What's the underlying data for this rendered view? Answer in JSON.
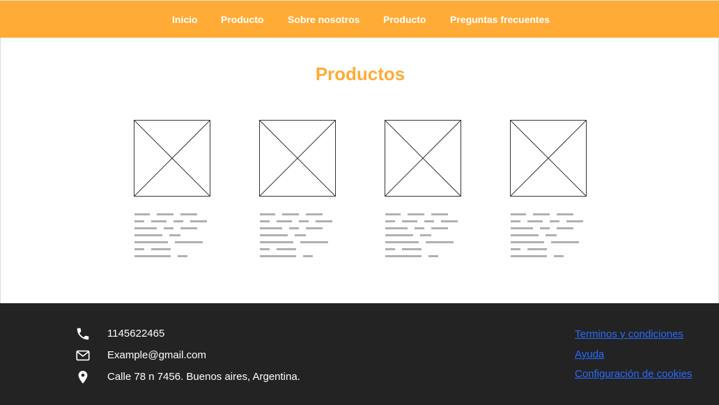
{
  "nav": {
    "items": [
      {
        "label": "Inicio"
      },
      {
        "label": "Producto"
      },
      {
        "label": "Sobre nosotros"
      },
      {
        "label": "Producto"
      },
      {
        "label": "Preguntas frecuentes"
      }
    ]
  },
  "main": {
    "title": "Productos",
    "product_count": 4
  },
  "footer": {
    "contact": [
      {
        "icon": "phone-icon",
        "text": "1145622465"
      },
      {
        "icon": "mail-icon",
        "text": "Example@gmail.com"
      },
      {
        "icon": "location-pin-icon",
        "text": "Calle 78 n 7456. Buenos aires, Argentina."
      }
    ],
    "links": [
      {
        "label": "Terminos y condiciones"
      },
      {
        "label": "Ayuda"
      },
      {
        "label": "Configuración de cookies"
      }
    ]
  },
  "colors": {
    "accent": "#ffab36",
    "footer_bg": "#232323",
    "link": "#2a6bff",
    "placeholder_text": "#b0b0b0"
  }
}
